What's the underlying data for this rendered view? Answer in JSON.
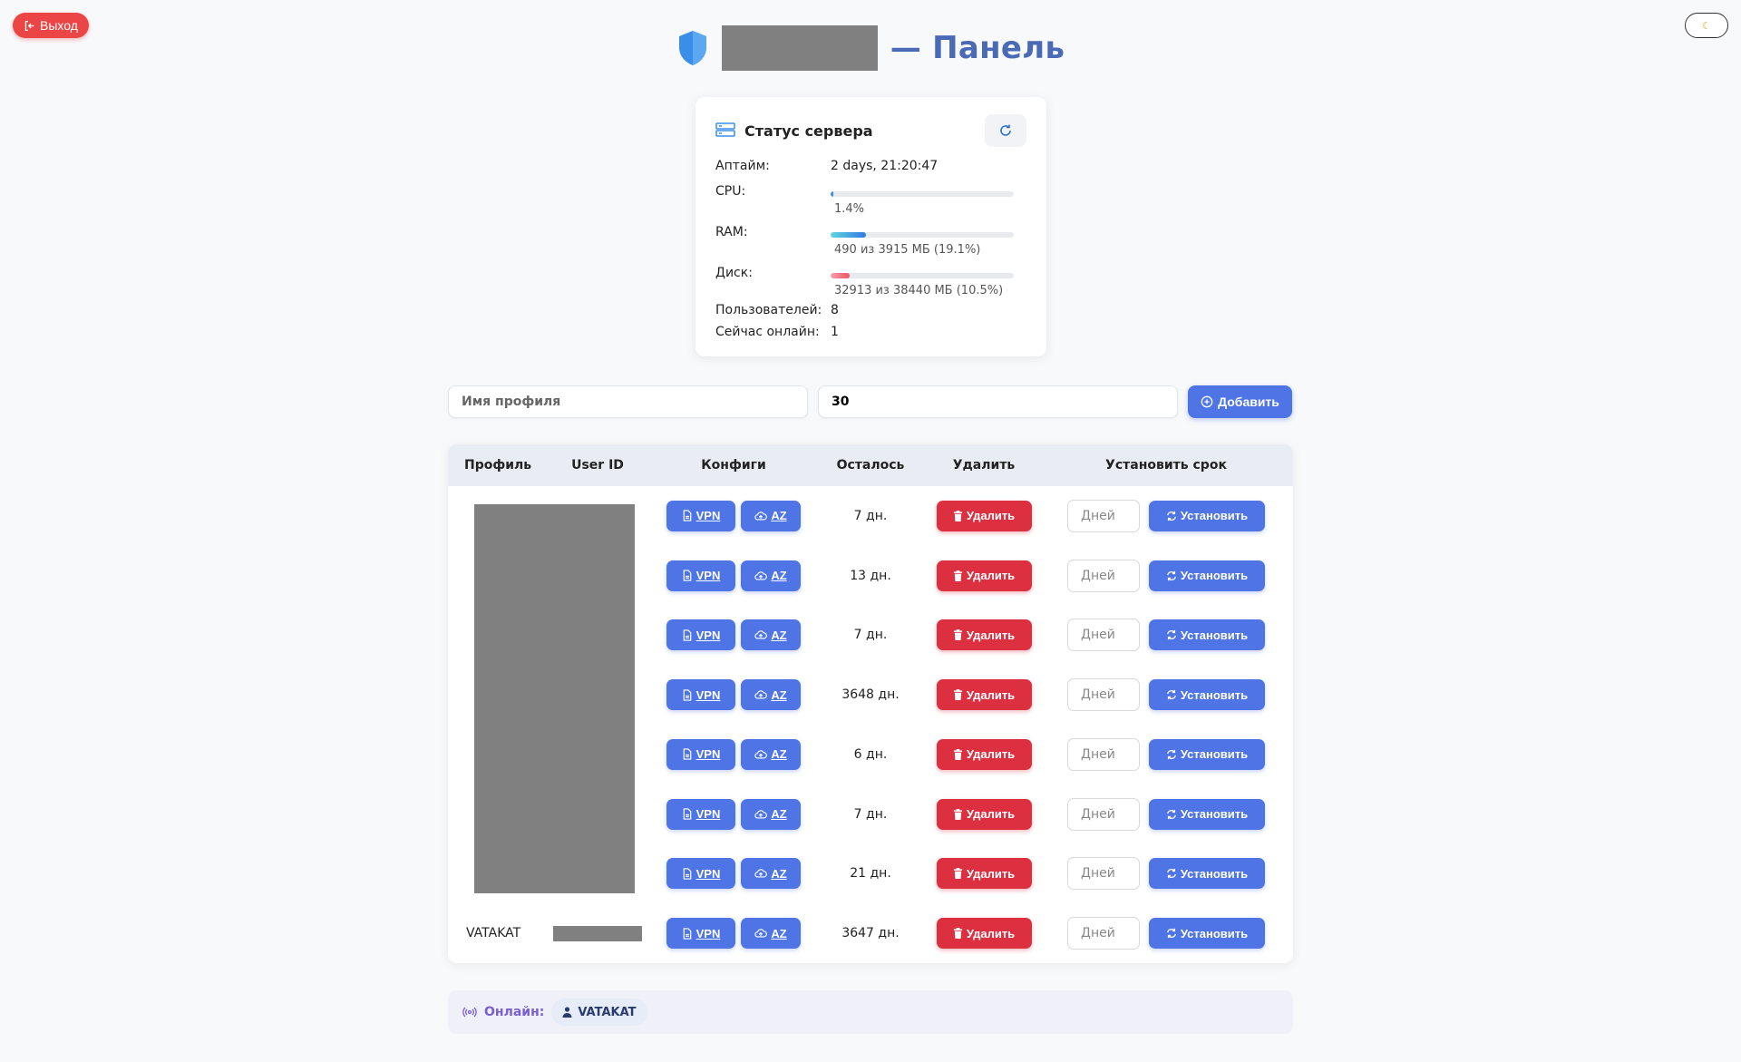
{
  "toolbar": {
    "logout_label": "Выход",
    "theme_icon": "moon-icon"
  },
  "header": {
    "title": "— Панель"
  },
  "status": {
    "title": "Статус сервера",
    "uptime_label": "Аптайм:",
    "uptime_value": "2 days, 21:20:47",
    "cpu_label": "CPU:",
    "cpu_caption": "1.4%",
    "cpu_percent": 1.4,
    "ram_label": "RAM:",
    "ram_caption": "490 из 3915 МБ (19.1%)",
    "ram_percent": 19.1,
    "disk_label": "Диск:",
    "disk_caption": "32913 из 38440 МБ (10.5%)",
    "disk_percent": 10.5,
    "users_label": "Пользователей:",
    "users_value": "8",
    "online_label": "Сейчас онлайн:",
    "online_value": "1"
  },
  "add_form": {
    "name_placeholder": "Имя профиля",
    "days_value": "30",
    "add_label": "Добавить"
  },
  "table": {
    "headers": [
      "Профиль",
      "User ID",
      "Конфиги",
      "Осталось",
      "Удалить",
      "Установить срок"
    ],
    "vpn_label": "VPN",
    "az_label": "AZ",
    "delete_label": "Удалить",
    "set_label": "Установить",
    "days_placeholder": "Дней",
    "rows": [
      {
        "profile": "",
        "remaining": "7 дн."
      },
      {
        "profile": "",
        "remaining": "13 дн."
      },
      {
        "profile": "",
        "remaining": "7 дн."
      },
      {
        "profile": "",
        "remaining": "3648 дн."
      },
      {
        "profile": "",
        "remaining": "6 дн."
      },
      {
        "profile": "",
        "remaining": "7 дн."
      },
      {
        "profile": "",
        "remaining": "21 дн."
      },
      {
        "profile": "VATAKAT",
        "remaining": "3647 дн."
      }
    ]
  },
  "online": {
    "label": "Онлайн:",
    "users": [
      "VATAKAT"
    ]
  },
  "colors": {
    "accent": "#4e74e6",
    "danger": "#dc3040",
    "title": "#4a6ab6"
  }
}
